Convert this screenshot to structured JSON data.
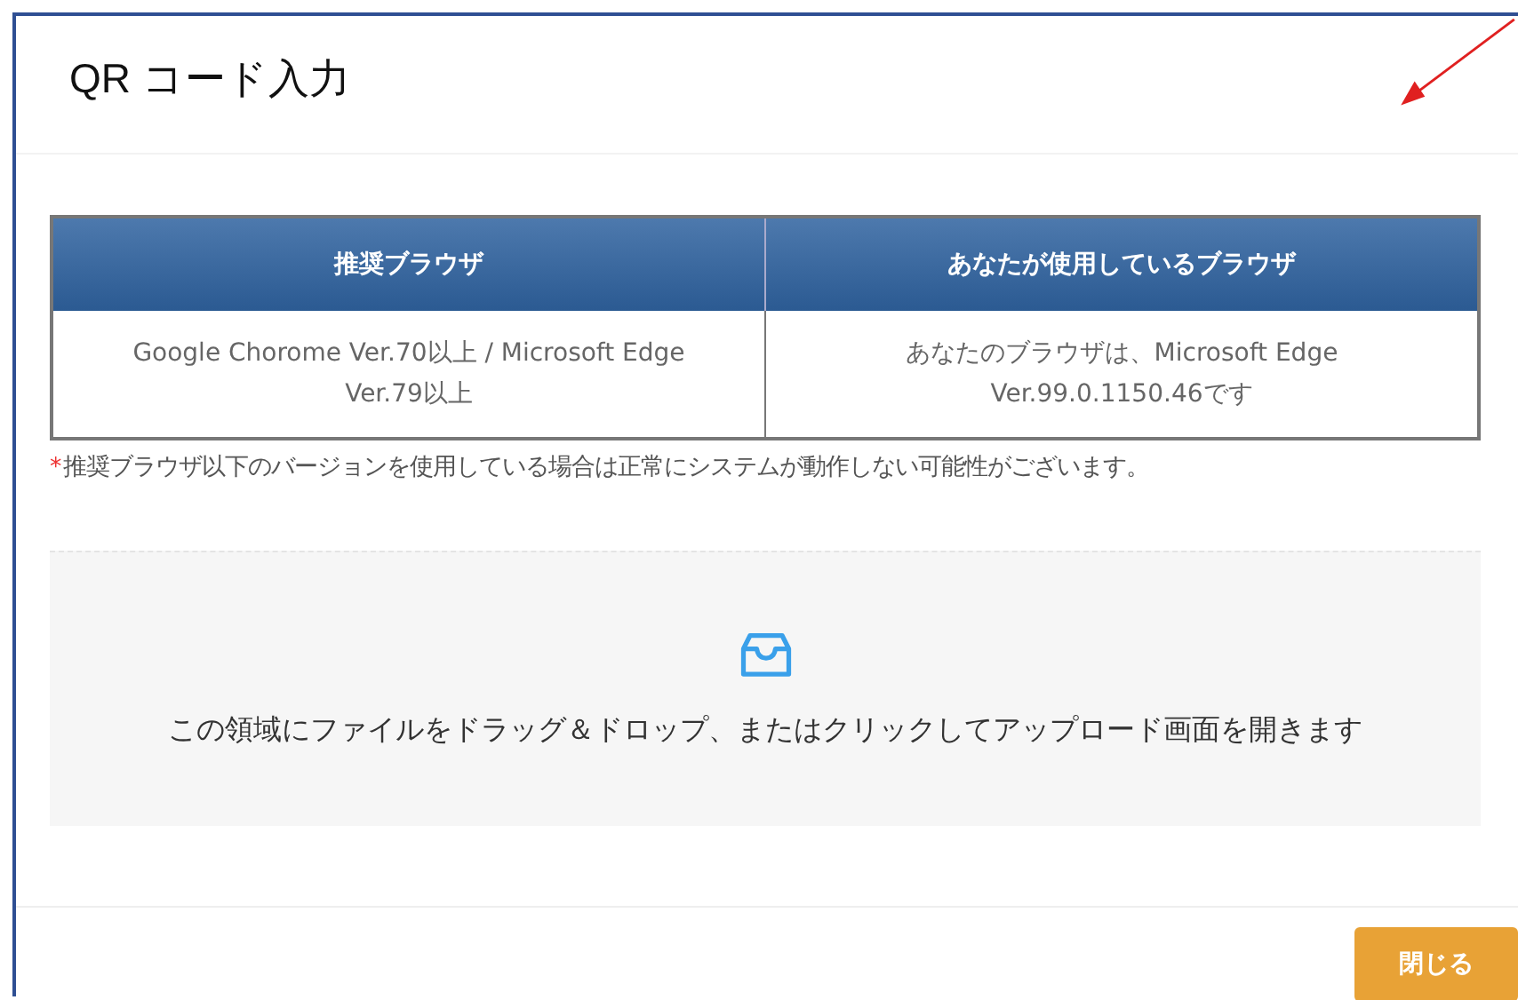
{
  "dialog": {
    "title": "QR コード入力"
  },
  "table": {
    "columns": [
      "推奨ブラウザ",
      "あなたが使用しているブラウザ"
    ],
    "rows": [
      [
        "Google Chorome Ver.70以上 / Microsoft Edge Ver.79以上",
        "あなたのブラウザは、Microsoft Edge Ver.99.0.1150.46です"
      ]
    ]
  },
  "note": {
    "mark": "*",
    "text": "推奨ブラウザ以下のバージョンを使用している場合は正常にシステムが動作しない可能性がございます。"
  },
  "dropzone": {
    "text": "この領域にファイルをドラッグ＆ドロップ、またはクリックしてアップロード画面を開きます"
  },
  "buttons": [
    "閉じる"
  ]
}
